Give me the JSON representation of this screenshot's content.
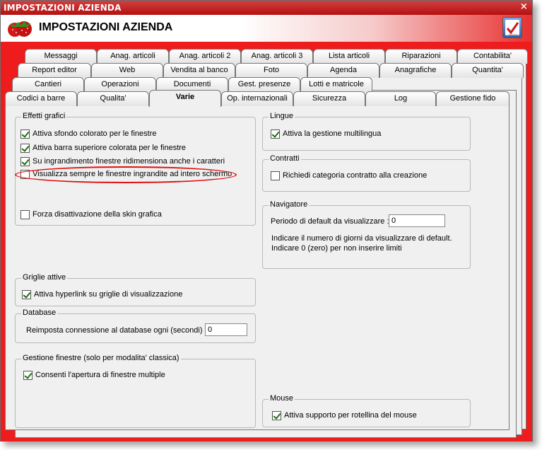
{
  "window": {
    "title": "IMPOSTAZIONI AZIENDA",
    "close_glyph": "×"
  },
  "header": {
    "title": "IMPOSTAZIONI AZIENDA",
    "logo_icon": "strawberry-logo",
    "right_icon": "checklist-icon"
  },
  "tabs": {
    "row1": [
      "Messaggi",
      "Anag. articoli",
      "Anag. articoli 2",
      "Anag. articoli 3",
      "Lista articoli",
      "Riparazioni",
      "Contabilita'"
    ],
    "row2": [
      "Report editor",
      "Web",
      "Vendita al banco",
      "Foto",
      "Agenda",
      "Anagrafiche",
      "Quantita'"
    ],
    "row3": [
      "Cantieri",
      "Operazioni",
      "Documenti",
      "Gest. presenze",
      "Lotti e matricole"
    ],
    "row4": [
      "Codici a barre",
      "Qualita'",
      "Varie",
      "Op. internazionali",
      "Sicurezza",
      "Log",
      "Gestione fido"
    ],
    "active": "Varie"
  },
  "effetti": {
    "title": "Effetti grafici",
    "items": [
      {
        "label": "Attiva sfondo colorato per le finestre",
        "checked": true
      },
      {
        "label": "Attiva barra superiore colorata per le finestre",
        "checked": true
      },
      {
        "label": "Su ingrandimento finestre ridimensiona anche i caratteri",
        "checked": true
      },
      {
        "label": "Visualizza sempre le finestre ingrandite ad intero schermo",
        "checked": false
      },
      {
        "label": "Forza disattivazione della skin grafica",
        "checked": false
      }
    ]
  },
  "griglie": {
    "title": "Griglie attive",
    "item": "Attiva hyperlink su griglie di visualizzazione",
    "checked": true
  },
  "database": {
    "title": "Database",
    "label": "Reimposta connessione al database ogni (secondi) :",
    "value": "0"
  },
  "gestione": {
    "title": "Gestione finestre (solo per modalita' classica)",
    "item": "Consenti l'apertura di finestre multiple",
    "checked": true
  },
  "lingue": {
    "title": "Lingue",
    "item": "Attiva la gestione multilingua",
    "checked": true
  },
  "contratti": {
    "title": "Contratti",
    "item": "Richiedi categoria contratto alla creazione",
    "checked": false
  },
  "navigatore": {
    "title": "Navigatore",
    "label": "Periodo di default da visualizzare :",
    "value": "0",
    "note1": "Indicare il numero di giorni da visualizzare di default.",
    "note2": "Indicare 0 (zero) per non inserire limiti"
  },
  "mouse": {
    "title": "Mouse",
    "item": "Attiva supporto per rotellina del mouse",
    "checked": true
  },
  "colors": {
    "accent": "#ee1c1c",
    "panel": "#f0f0f0",
    "highlight": "#e01010"
  }
}
